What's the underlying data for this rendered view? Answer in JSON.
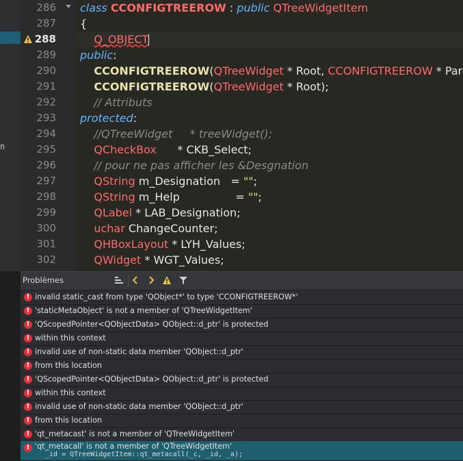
{
  "sidebar_mark": "n",
  "editor": {
    "lines": [
      {
        "n": "286",
        "html": "<span class='k'>class</span> <span class='cl' style='font-weight:bold'>CCONFIGTREEROW</span> : <span class='k'>public</span> <span class='ty'>QTreeWidgetItem</span>"
      },
      {
        "n": "287",
        "html": "{"
      },
      {
        "n": "288",
        "html": "    <span class='macro'>Q_OBJECT</span><span class='caret'></span>",
        "current": true,
        "warning": true
      },
      {
        "n": "289",
        "html": "<span class='k'>public</span>:"
      },
      {
        "n": "290",
        "html": "    <span class='fn'>CCONFIGTREEROW</span>(<span class='ty'>QTreeWidget</span> * Root, <span class='ty'>CCONFIGTREEROW</span> * Parent);"
      },
      {
        "n": "291",
        "html": "    <span class='fn'>CCONFIGTREEROW</span>(<span class='ty'>QTreeWidget</span> * Root);"
      },
      {
        "n": "292",
        "html": "    <span class='cm'>// Attributs</span>"
      },
      {
        "n": "293",
        "html": "<span class='k'>protected</span>:"
      },
      {
        "n": "294",
        "html": "    <span class='cm'>//QTreeWidget     * treeWidget();</span>"
      },
      {
        "n": "295",
        "html": "    <span class='ty'>QCheckBox</span>      * CKB_Select;"
      },
      {
        "n": "296",
        "html": "    <span class='cm'>// pour ne pas afficher les &amp;Desgnation</span>"
      },
      {
        "n": "297",
        "html": "    <span class='ty'>QString</span> m_Designation   = <span class='st'>\"\"</span>;"
      },
      {
        "n": "298",
        "html": "    <span class='ty'>QString</span> m_Help                = <span class='st'>\"\"</span>;"
      },
      {
        "n": "299",
        "html": "    <span class='ty'>QLabel</span> * LAB_Designation;"
      },
      {
        "n": "300",
        "html": "    <span class='ty'>uchar</span> ChangeCounter;"
      },
      {
        "n": "301",
        "html": "    <span class='ty'>QHBoxLayout</span> * LYH_Values;"
      },
      {
        "n": "302",
        "html": "    <span class='ty'>QWidget</span> * WGT_Values;"
      }
    ]
  },
  "panel": {
    "title": "Problèmes",
    "issues": [
      "invalid static_cast from type 'QObject*' to type 'CCONFIGTREEROW*'",
      "'staticMetaObject' is not a member of 'QTreeWidgetItem'",
      "'QScopedPointer<QObjectData> QObject::d_ptr' is protected",
      "within this context",
      "invalid use of non-static data member 'QObject::d_ptr'",
      "from this location",
      "'QScopedPointer<QObjectData> QObject::d_ptr' is protected",
      "within this context",
      "invalid use of non-static data member 'QObject::d_ptr'",
      "from this location",
      "'qt_metacast' is not a member of 'QTreeWidgetItem'"
    ],
    "selected_issue": "'qt_metacall' is not a member of 'QTreeWidgetItem'",
    "selected_detail": "_id = QTreeWidgetItem::qt_metacall(_c, _id, _a);"
  }
}
